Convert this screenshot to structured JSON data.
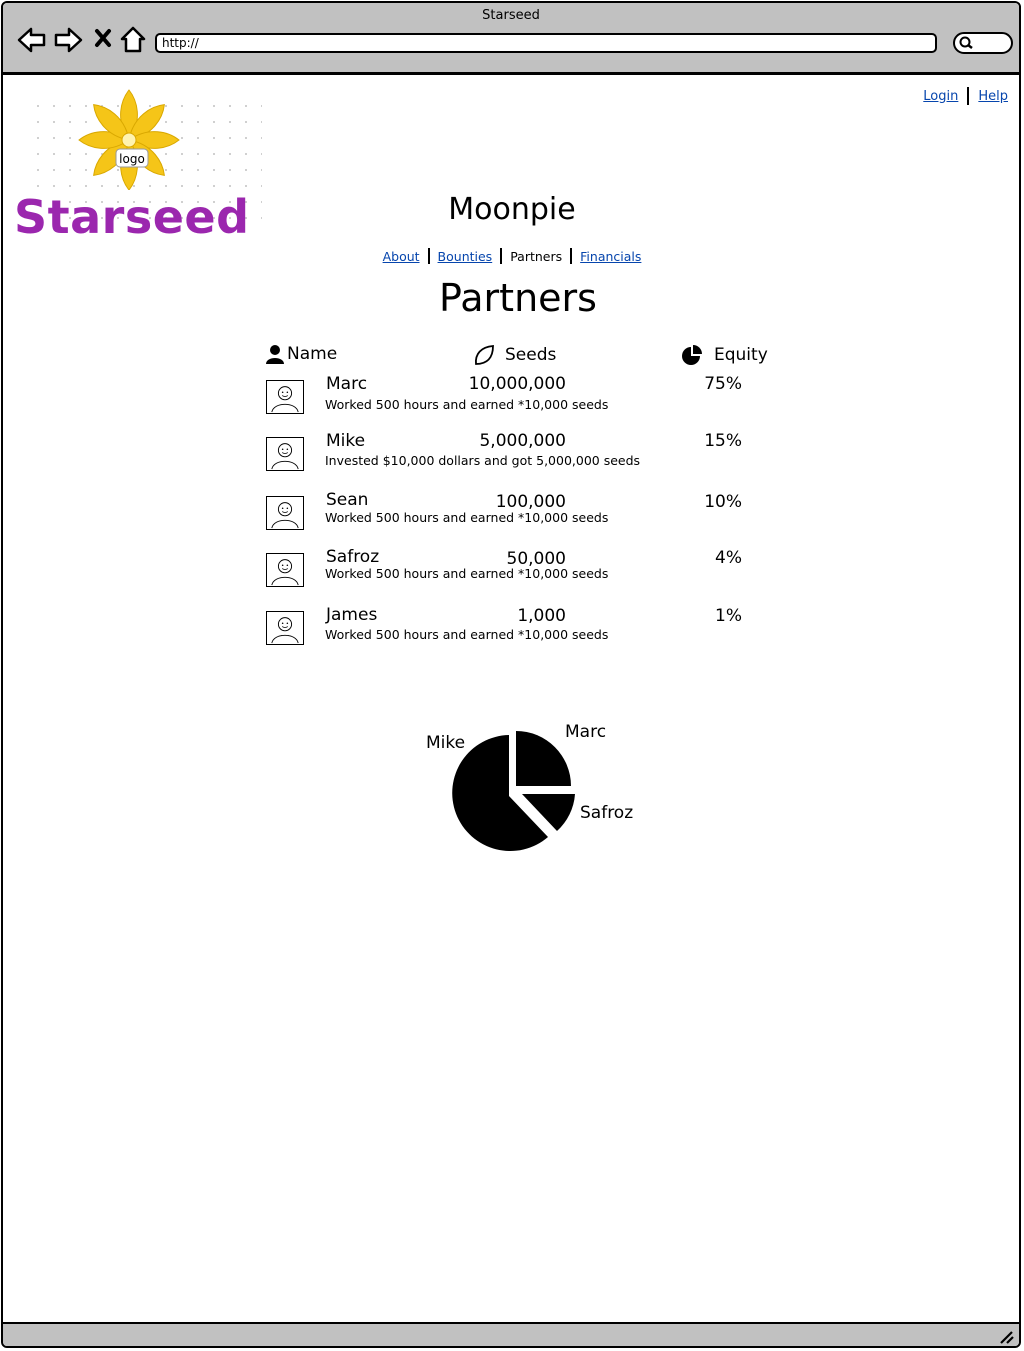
{
  "window": {
    "title": "Starseed",
    "url": "http://"
  },
  "brand": {
    "logo_text": "logo",
    "name": "Starseed",
    "color": "#9b27ae",
    "flower_color": "#f5c518"
  },
  "header_links": {
    "login": "Login",
    "help": "Help"
  },
  "project": {
    "name": "Moonpie"
  },
  "tabs": [
    {
      "label": "About",
      "active": false
    },
    {
      "label": "Bounties",
      "active": false
    },
    {
      "label": "Partners",
      "active": true
    },
    {
      "label": "Financials",
      "active": false
    }
  ],
  "page": {
    "title": "Partners"
  },
  "columns": {
    "name": "Name",
    "seeds": "Seeds",
    "equity": "Equity"
  },
  "partners": [
    {
      "name": "Marc",
      "seeds": "10,000,000",
      "equity": "75%",
      "description": "Worked 500 hours and earned *10,000 seeds"
    },
    {
      "name": "Mike",
      "seeds": "5,000,000",
      "equity": "15%",
      "description": "Invested $10,000 dollars and got 5,000,000 seeds"
    },
    {
      "name": "Sean",
      "seeds": "100,000",
      "equity": "10%",
      "description": "Worked 500 hours and earned *10,000 seeds"
    },
    {
      "name": "Safroz",
      "seeds": "50,000",
      "equity": "4%",
      "description": "Worked 500 hours and earned *10,000 seeds"
    },
    {
      "name": "James",
      "seeds": "1,000",
      "equity": "1%",
      "description": "Worked 500 hours and earned *10,000 seeds"
    }
  ],
  "pie": {
    "labels": {
      "mike": "Mike",
      "marc": "Marc",
      "safroz": "Safroz"
    }
  }
}
